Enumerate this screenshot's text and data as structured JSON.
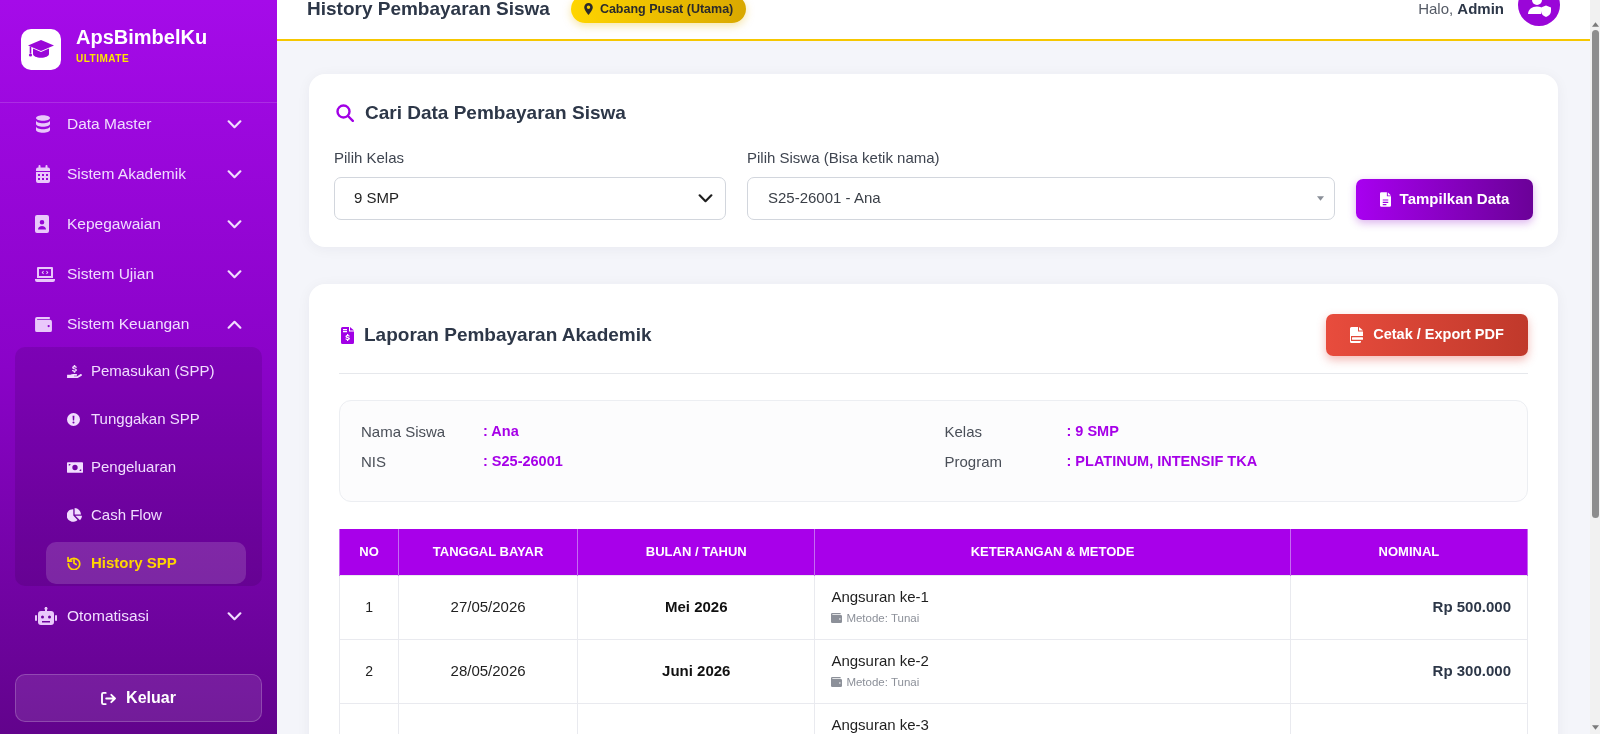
{
  "sidebar": {
    "brand": {
      "name": "ApsBimbelKu",
      "edition": "ULTIMATE"
    },
    "menu": [
      {
        "label": "Data Master",
        "expanded": false
      },
      {
        "label": "Sistem Akademik",
        "expanded": false
      },
      {
        "label": "Kepegawaian",
        "expanded": false
      },
      {
        "label": "Sistem Ujian",
        "expanded": false
      },
      {
        "label": "Sistem Keuangan",
        "expanded": true,
        "children": [
          {
            "label": "Pemasukan (SPP)",
            "selected": false
          },
          {
            "label": "Tunggakan SPP",
            "selected": false
          },
          {
            "label": "Pengeluaran",
            "selected": false
          },
          {
            "label": "Cash Flow",
            "selected": false
          },
          {
            "label": "History SPP",
            "selected": true
          }
        ]
      },
      {
        "label": "Otomatisasi",
        "expanded": false
      }
    ],
    "logout_button": "Keluar"
  },
  "header": {
    "title": "History Pembayaran Siswa",
    "branch_badge": "Cabang Pusat (Utama)",
    "greeting": "Halo, **Admin**"
  },
  "search_card": {
    "title": "Cari Data Pembayaran Siswa",
    "fields": [
      {
        "kind": "select",
        "label": "Pilih Kelas",
        "value": "9 SMP"
      },
      {
        "kind": "combobox",
        "label": "Pilih Siswa (Bisa ketik nama)",
        "value": "S25-26001 - Ana"
      }
    ],
    "submit_button": "Tampilkan Data"
  },
  "report_card": {
    "title": "Laporan Pembayaran Akademik",
    "export_button": "Cetak / Export PDF",
    "student_info": [
      {
        "label": "Nama Siswa",
        "value": ": Ana"
      },
      {
        "label": "Kelas",
        "value": ": 9 SMP"
      },
      {
        "label": "NIS",
        "value": ": S25-26001"
      },
      {
        "label": "Program",
        "value": ": PLATINUM, INTENSIF TKA"
      }
    ],
    "table": {
      "columns": [
        "NO",
        "TANGGAL BAYAR",
        "BULAN / TAHUN",
        "KETERANGAN & METODE",
        "NOMINAL"
      ],
      "rows": [
        {
          "no": "1",
          "payment_date": "27/05/2026",
          "period": "Mei 2026",
          "description": "Angsuran ke-1",
          "method": "Metode: Tunai",
          "amount": "Rp 500.000"
        },
        {
          "no": "2",
          "payment_date": "28/05/2026",
          "period": "Juni 2026",
          "description": "Angsuran ke-2",
          "method": "Metode: Tunai",
          "amount": "Rp 300.000"
        },
        {
          "description": "Angsuran ke-3"
        }
      ]
    }
  }
}
